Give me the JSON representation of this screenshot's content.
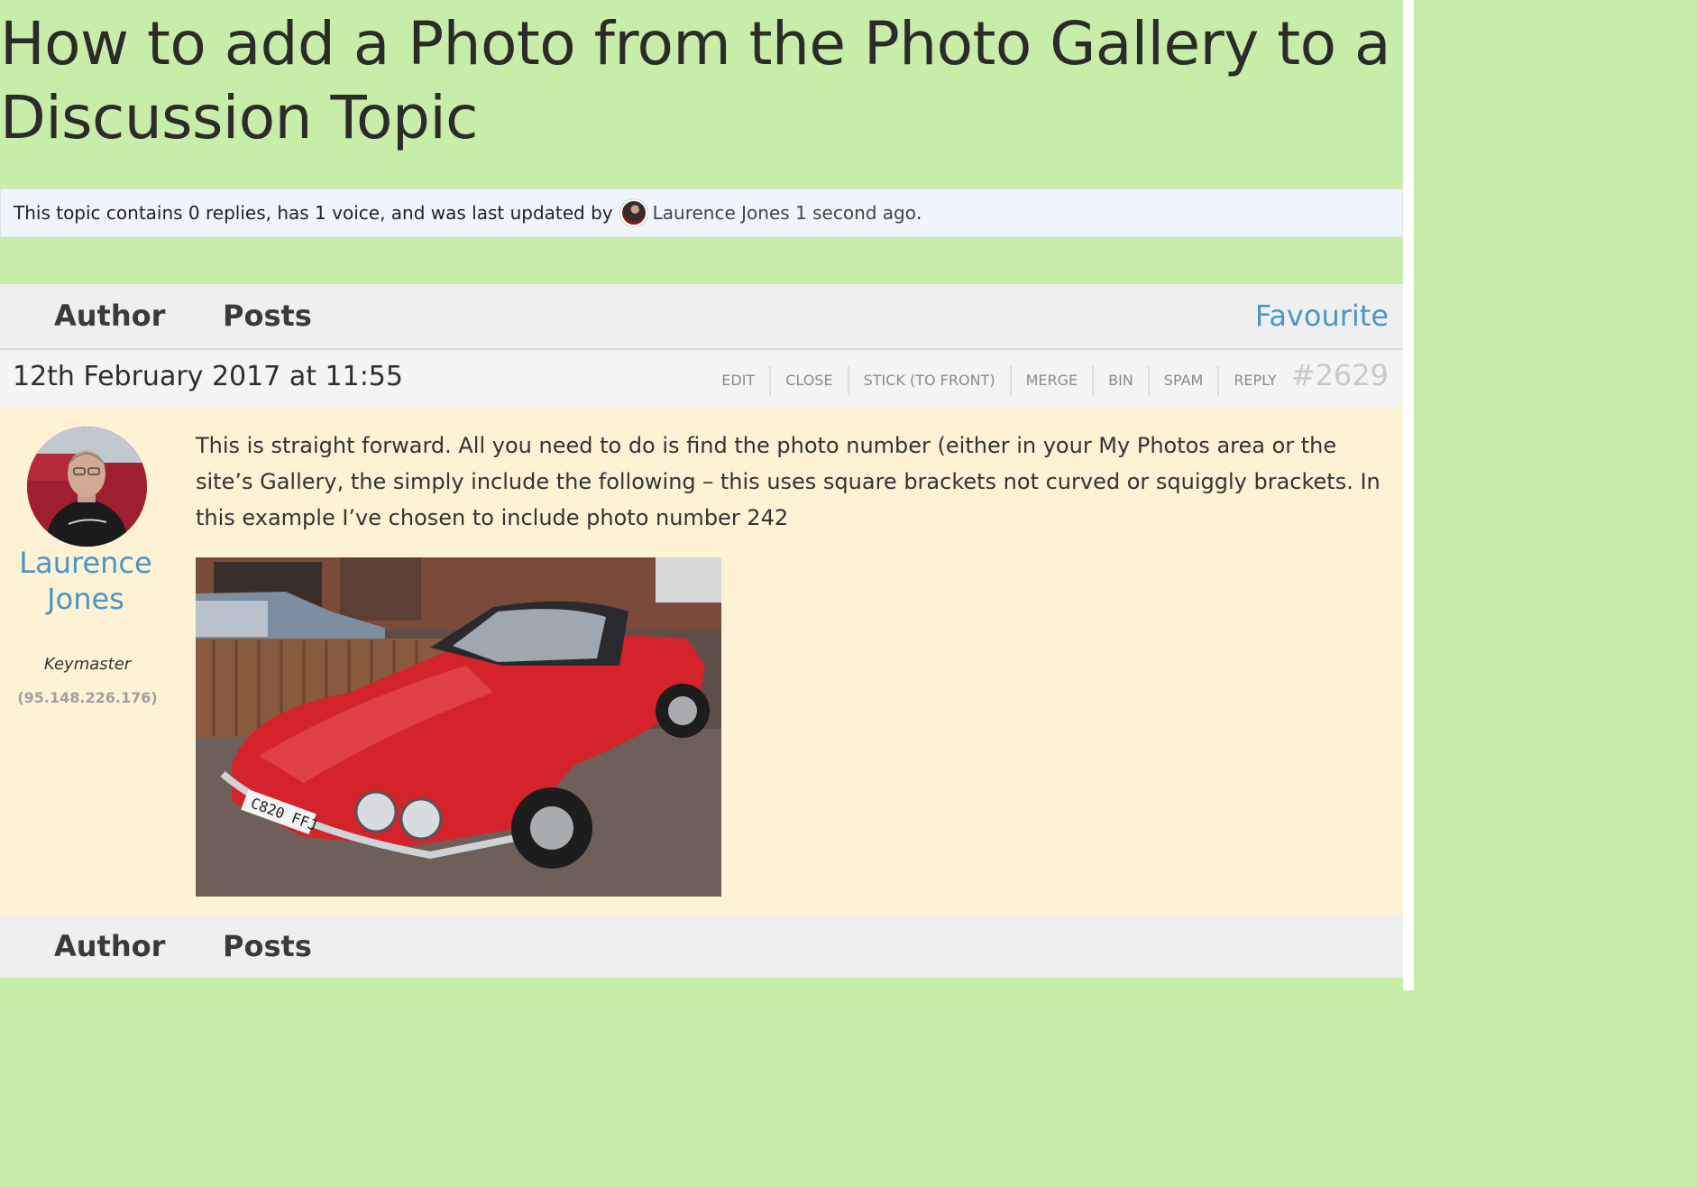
{
  "topic": {
    "title": "How to add a Photo from the Photo Gallery to a Discussion Topic"
  },
  "notice": {
    "text_before": "This topic contains 0 replies, has 1 voice, and was last updated by",
    "user": "Laurence Jones",
    "time": "1 second ago",
    "text_after": "."
  },
  "table_header": {
    "author": "Author",
    "posts": "Posts",
    "favourite": "Favourite"
  },
  "post": {
    "date": "12th February 2017 at 11:55",
    "actions": [
      "Edit",
      "Close",
      "Stick (To Front)",
      "Merge",
      "Bin",
      "Spam",
      "Reply"
    ],
    "id": "#2629",
    "author_name": "Laurence Jones",
    "author_role": "Keymaster",
    "author_ip": "(95.148.226.176)",
    "content": "This is straight forward. All you need to do is find the photo number (either in your My Photos area or the site’s Gallery, the simply include the following – this uses square brackets not curved or squiggly brackets. In this example I’ve chosen to include photo number 242",
    "photo_plate": "C820 FFJ"
  },
  "table_footer": {
    "author": "Author",
    "posts": "Posts"
  },
  "colors": {
    "page_bg": "#c8eda8",
    "link": "#4b95c8",
    "post_bg": "#fdf2d4",
    "notice_bg": "#eef5fc"
  }
}
